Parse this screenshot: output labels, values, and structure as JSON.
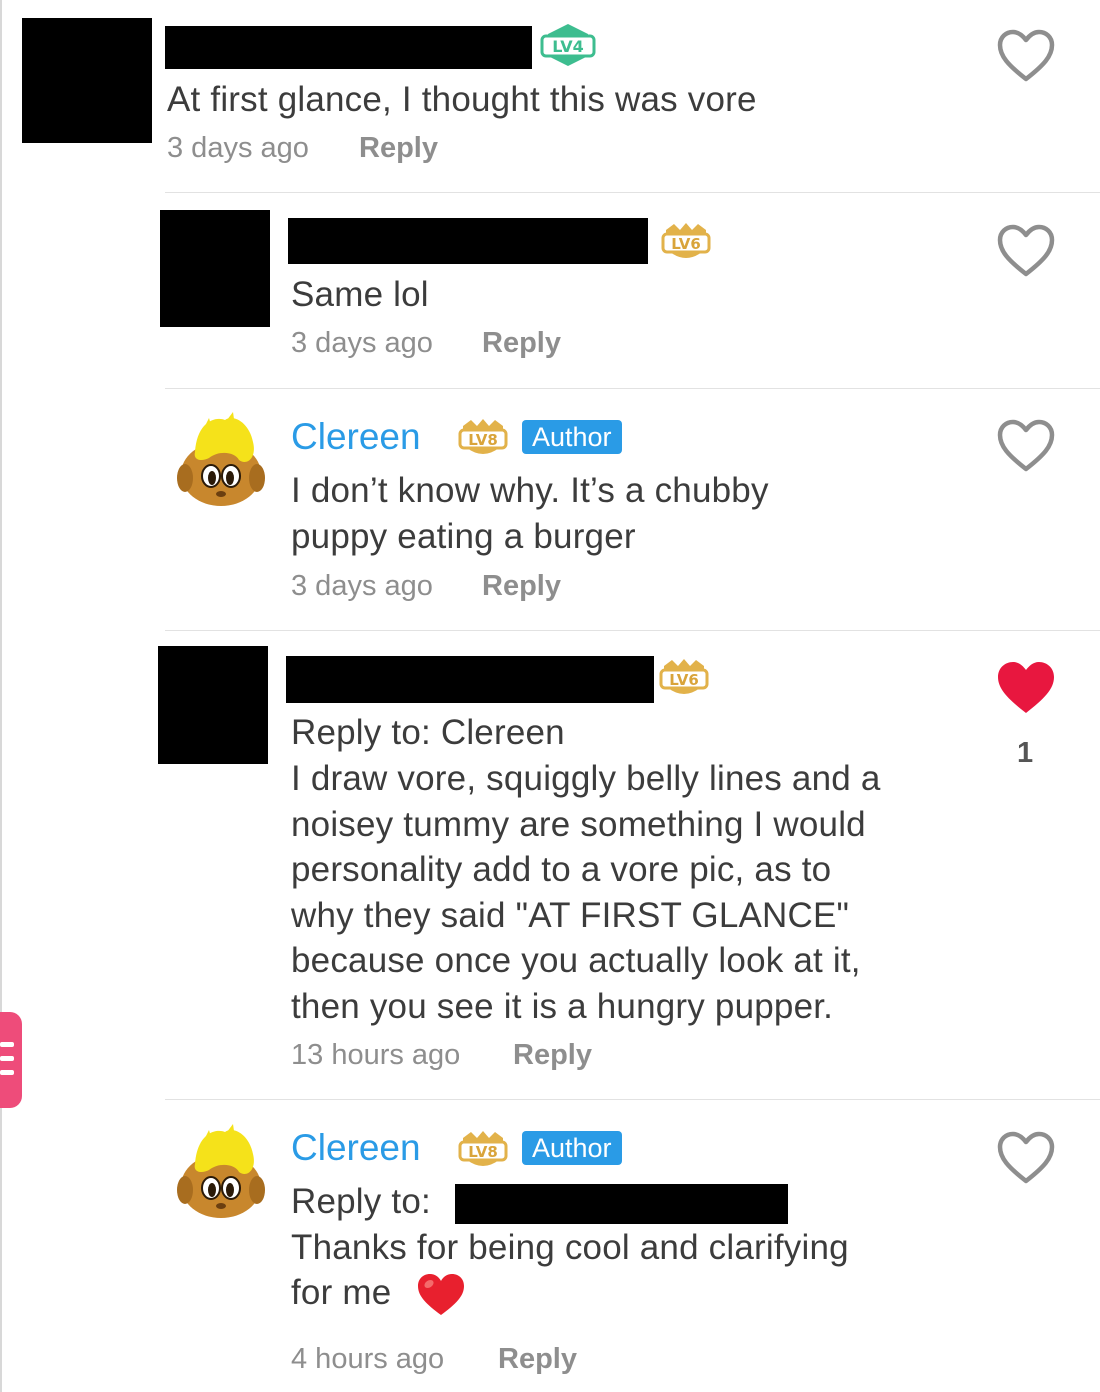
{
  "comments": [
    {
      "level": "LV4",
      "text": "At first glance, I thought this was vore",
      "time": "3 days ago",
      "reply": "Reply",
      "liked": false
    },
    {
      "level": "LV6",
      "text": "Same lol",
      "time": "3 days ago",
      "reply": "Reply",
      "liked": false
    },
    {
      "author_name": "Clereen",
      "level": "LV8",
      "badge": "Author",
      "lines": [
        "I don’t know why. It’s a chubby",
        "puppy eating a burger"
      ],
      "time": "3 days ago",
      "reply": "Reply",
      "liked": false
    },
    {
      "level": "LV6",
      "reply_to": "Reply to: Clereen",
      "lines": [
        "I draw vore, squiggly belly lines and a",
        "noisey tummy are something I would",
        "personality add to a vore pic, as to",
        "why they said \"AT FIRST GLANCE\"",
        "because once you actually look at it,",
        "then you see it is a hungry pupper."
      ],
      "time": "13 hours ago",
      "reply": "Reply",
      "liked": true,
      "like_count": "1"
    },
    {
      "author_name": "Clereen",
      "level": "LV8",
      "badge": "Author",
      "reply_to_label": "Reply to:",
      "lines": [
        "Thanks for being cool and clarifying",
        "for me"
      ],
      "emoji": "red-heart",
      "time": "4 hours ago",
      "reply": "Reply",
      "liked": false
    }
  ],
  "colors": {
    "username": "#2a9be6",
    "author_badge": "#2a9be6",
    "liked_heart": "#e8173f",
    "level_gold": "#e2b24a",
    "level_teal": "#3dbd8f",
    "side_tab": "#ee4c7a"
  }
}
